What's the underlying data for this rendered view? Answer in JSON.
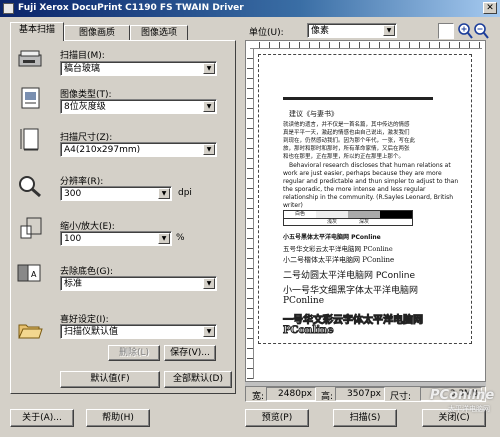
{
  "window": {
    "title": "Fuji Xerox DocuPrint C1190 FS TWAIN Driver"
  },
  "tabs": [
    {
      "label": "基本扫描"
    },
    {
      "label": "图像画质"
    },
    {
      "label": "图像选项"
    }
  ],
  "scan_target": {
    "label": "扫描目(M):",
    "value": "稿台玻璃"
  },
  "image_type": {
    "label": "图像类型(T):",
    "value": "8位灰度级"
  },
  "scan_size": {
    "label": "扫描尺寸(Z):",
    "value": "A4(210x297mm)"
  },
  "resolution": {
    "label": "分辨率(R):",
    "value": "300",
    "unit": "dpi"
  },
  "zoom": {
    "label": "缩小/放大(E):",
    "value": "100",
    "unit": "%"
  },
  "remove_bg": {
    "label": "去除底色(G):",
    "value": "标准"
  },
  "favorites": {
    "label": "喜好设定(I):",
    "value": "扫描仪默认值"
  },
  "buttons": {
    "delete": "删除(L)",
    "save": "保存(V)...",
    "default": "默认值(F)",
    "all_default": "全部默认(D)",
    "about": "关于(A)...",
    "help": "帮助(H)",
    "preview": "预览(P)",
    "scan": "扫描(S)",
    "close": "关闭(C)"
  },
  "preview_toolbar": {
    "unit_label": "单位(U):",
    "unit_value": "像素"
  },
  "info_bar": {
    "width_label": "宽:",
    "width_value": "2480px",
    "height_label": "高:",
    "height_value": "3507px",
    "size_label": "尺寸:",
    "size_value": "3.3MB"
  },
  "document": {
    "line1": "建议《与妻书》",
    "para1a": "就读他的遗言，并不仅是一首名篇，其中传达的情感",
    "para1b": "真是平平一天，激起的情感也由自己说出，激发我们",
    "para1c": "到现在，仍然感动我们。因为那个年代，一张，写在此",
    "para1d": "旅，那时和那时和那时，所有革命家情，又后在两张",
    "para1e": "和也在那里，正在那里，所以的正在那里上那个。",
    "en1": "Behavioral research discloses that human relations at",
    "en2": "work are just easier, perhaps because they are more",
    "en3": "regular and predictable and thun simpler to adjust to than",
    "en4": "the sporadic, the more intense and less regular",
    "en5": "relationship in the community. (R.Sayles Leonard, British",
    "en6": "writer)",
    "tbl_white": "白色",
    "tbl_light": "浅灰",
    "tbl_dark": "深灰",
    "f1": "小五号黑体太平洋电脑网 PConline",
    "f2": "五号华文彩云太平洋电脑网 PConline",
    "f3": "小二号楷体太平洋电脑网 PConline",
    "f4": "二号幼圆太平洋电脑网 PConline",
    "f5": "小一号华文细黑字体太平洋电脑网",
    "f6": "PConline",
    "f7": "一号华文彩云字体太平洋电脑网",
    "f8": "PConline"
  },
  "watermark": {
    "text": "PConline",
    "sub": "太平洋电脑网"
  }
}
